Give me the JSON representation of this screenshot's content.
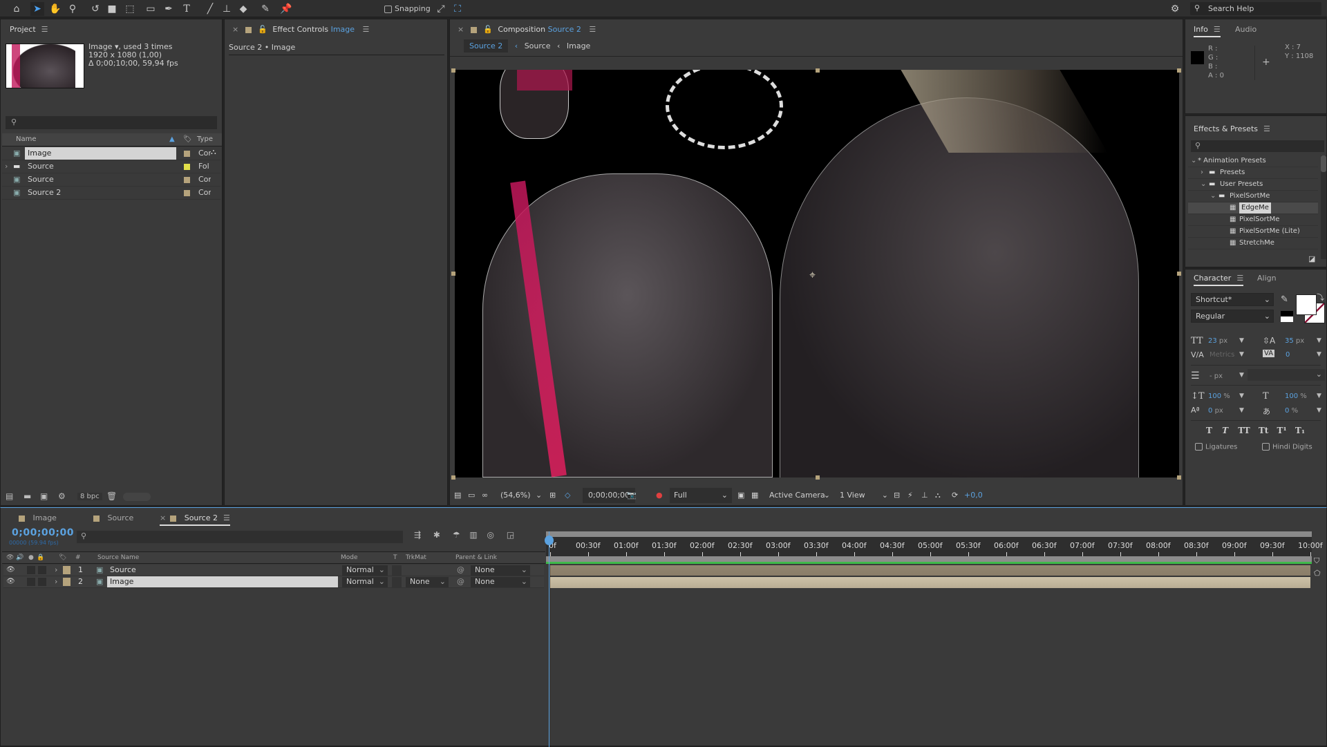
{
  "toolbar": {
    "tools": [
      "home-icon",
      "selection-tool-icon",
      "hand-tool-icon",
      "zoom-tool-icon",
      "rotate-tool-icon",
      "camera-tool-icon",
      "pan-behind-tool-icon",
      "rectangle-tool-icon",
      "pen-tool-icon",
      "type-tool-icon",
      "brush-tool-icon",
      "clone-stamp-tool-icon",
      "eraser-tool-icon",
      "roto-brush-tool-icon",
      "puppet-pin-tool-icon"
    ],
    "snapping_label": "Snapping",
    "search_help_placeholder": "Search Help"
  },
  "project": {
    "title": "Project",
    "item_name": "Image",
    "item_usage": ", used 3 times",
    "item_dims": "1920 x 1080 (1,00)",
    "item_duration": "Δ 0;00;10;00, 59,94 fps",
    "columns": {
      "name": "Name",
      "type": "Type"
    },
    "items": [
      {
        "name": "Image",
        "type": "Cor",
        "kind": "composition",
        "color": "#b5a37c",
        "selected": true
      },
      {
        "name": "Source",
        "type": "Fol",
        "kind": "folder",
        "color": "#e2e04a",
        "selected": false
      },
      {
        "name": "Source",
        "type": "Cor",
        "kind": "composition",
        "color": "#b5a37c",
        "selected": false
      },
      {
        "name": "Source 2",
        "type": "Cor",
        "kind": "composition",
        "color": "#b5a37c",
        "selected": false
      }
    ],
    "bpc": "8 bpc"
  },
  "effect_controls": {
    "title": "Effect Controls",
    "layer": "Image",
    "subtitle": "Source 2 • Image"
  },
  "composition": {
    "title": "Composition",
    "comp_name": "Source 2",
    "breadcrumbs": [
      "Source 2",
      "Source",
      "Image"
    ],
    "zoom": "(54,6%)",
    "timecode": "0;00;00;00",
    "resolution": "Full",
    "camera": "Active Camera",
    "view": "1 View",
    "exposure": "+0,0"
  },
  "info": {
    "tabs": [
      "Info",
      "Audio"
    ],
    "r": "R :",
    "g": "G :",
    "b": "B :",
    "a": "A :  0",
    "x": "X : 7",
    "y": "Y : 1108"
  },
  "effects_presets": {
    "title": "Effects & Presets",
    "tree": [
      {
        "label": "* Animation Presets",
        "depth": 0,
        "kind": "root",
        "expanded": true
      },
      {
        "label": "Presets",
        "depth": 1,
        "kind": "folder",
        "expanded": false
      },
      {
        "label": "User Presets",
        "depth": 1,
        "kind": "folder",
        "expanded": true
      },
      {
        "label": "PixelSortMe",
        "depth": 2,
        "kind": "folder",
        "expanded": true
      },
      {
        "label": "EdgeMe",
        "depth": 3,
        "kind": "preset",
        "selected": true
      },
      {
        "label": "PixelSortMe",
        "depth": 3,
        "kind": "preset"
      },
      {
        "label": "PixelSortMe (Lite)",
        "depth": 3,
        "kind": "preset"
      },
      {
        "label": "StretchMe",
        "depth": 3,
        "kind": "preset"
      }
    ]
  },
  "character": {
    "tabs": [
      "Character",
      "Align"
    ],
    "font": "Shortcut*",
    "style": "Regular",
    "font_size": "23",
    "leading": "35",
    "kerning": "Metrics",
    "tracking": "0",
    "stroke_width": "-",
    "vscale": "100",
    "hscale": "100",
    "baseline": "0",
    "tsume": "0",
    "unit_px": "px",
    "unit_pct": "%",
    "ligatures": "Ligatures",
    "hindi_digits": "Hindi Digits",
    "style_buttons": [
      "T",
      "T",
      "TT",
      "Tt",
      "T¹",
      "T₁"
    ]
  },
  "timeline": {
    "tabs": [
      {
        "label": "Image",
        "active": false
      },
      {
        "label": "Source",
        "active": false
      },
      {
        "label": "Source 2",
        "active": true
      }
    ],
    "timecode": "0;00;00;00",
    "frame_info": "00000 (59.94 fps)",
    "columns": {
      "num": "#",
      "source_name": "Source Name",
      "mode": "Mode",
      "t": "T",
      "trkmat": "TrkMat",
      "parent": "Parent & Link"
    },
    "layers": [
      {
        "num": "1",
        "name": "Source",
        "mode": "Normal",
        "trkmat": "",
        "parent": "None",
        "selected": false
      },
      {
        "num": "2",
        "name": "Image",
        "mode": "Normal",
        "trkmat": "None",
        "parent": "None",
        "selected": true
      }
    ],
    "ruler": [
      "0f",
      "00:30f",
      "01:00f",
      "01:30f",
      "02:00f",
      "02:30f",
      "03:00f",
      "03:30f",
      "04:00f",
      "04:30f",
      "05:00f",
      "05:30f",
      "06:00f",
      "06:30f",
      "07:00f",
      "07:30f",
      "08:00f",
      "08:30f",
      "09:00f",
      "09:30f",
      "10:00f"
    ]
  },
  "colors": {
    "accent": "#5ba2e0",
    "label_tan": "#b5a37c",
    "label_yellow": "#e2e04a",
    "work_area": "#3fb94a"
  }
}
